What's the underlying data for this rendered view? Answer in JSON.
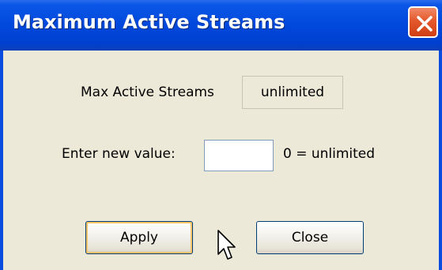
{
  "window": {
    "title": "Maximum Active Streams"
  },
  "form": {
    "max_label": "Max Active Streams",
    "max_value": "unlimited",
    "enter_label": "Enter new value:",
    "input_value": "",
    "hint": "0 = unlimited"
  },
  "buttons": {
    "apply": "Apply",
    "close": "Close"
  },
  "icons": {
    "close": "close-icon",
    "cursor": "mouse-pointer-icon"
  },
  "colors": {
    "titlebar": "#0048dc",
    "close_button": "#e4582c",
    "dialog_bg": "#ece9d8"
  }
}
